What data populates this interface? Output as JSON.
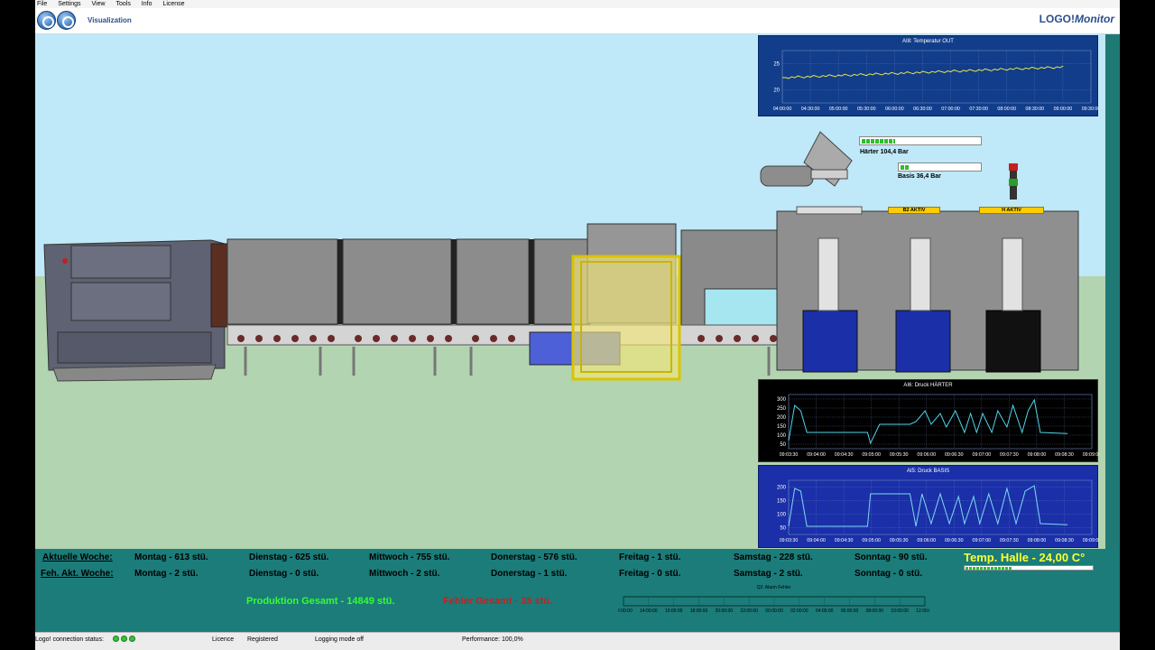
{
  "menu": [
    "File",
    "Settings",
    "View",
    "Tools",
    "Info",
    "License"
  ],
  "toolbar": {
    "title": "Visualization",
    "brand_prefix": "LOGO!",
    "brand_suffix": "Monitor"
  },
  "temperature_chart": {
    "title": "AI8: Temperatur OUT",
    "y_ticks": [
      "25",
      "20"
    ],
    "x_ticks": [
      "04:00:00",
      "04:30:00",
      "05:00:00",
      "05:30:00",
      "06:00:00",
      "06:30:00",
      "07:00:00",
      "07:30:00",
      "08:00:00",
      "08:30:00",
      "09:00:00",
      "09:30:00"
    ]
  },
  "pressure_haerter_chart": {
    "title": "AI6: Druck HÄRTER",
    "y_ticks": [
      "300",
      "250",
      "200",
      "150",
      "100",
      "50"
    ],
    "x_ticks": [
      "09:03:30",
      "09:04:00",
      "09:04:30",
      "09:05:00",
      "09:05:30",
      "09:06:00",
      "09:06:30",
      "09:07:00",
      "09:07:30",
      "09:08:00",
      "09:08:30",
      "09:09:00"
    ]
  },
  "pressure_basis_chart": {
    "title": "AI5: Druck BASIS",
    "y_ticks": [
      "200",
      "150",
      "100",
      "50"
    ],
    "x_ticks": [
      "09:03:30",
      "09:04:00",
      "09:04:30",
      "09:05:00",
      "09:05:30",
      "09:06:00",
      "09:06:30",
      "09:07:00",
      "09:07:30",
      "09:08:00",
      "09:08:30",
      "09:09:00"
    ]
  },
  "gauges": {
    "haerter_label": "Härter 104,4 Bar",
    "haerter_level": 0.28,
    "basis_label": "Basis 36,4 Bar",
    "basis_level": 0.1
  },
  "machine_tags": {
    "b2": "B2 AKTIV",
    "h": "H AKTIV"
  },
  "weekly": {
    "current_week_label": "Aktuelle Woche:",
    "error_week_label": "Feh. Akt. Woche:",
    "current": [
      "Montag - 613 stü.",
      "Dienstag - 625 stü.",
      "Mittwoch - 755 stü.",
      "Donerstag - 576 stü.",
      "Freitag - 1 stü.",
      "Samstag - 228 stü.",
      "Sonntag - 90 stü."
    ],
    "errors": [
      "Montag - 2 stü.",
      "Dienstag - 0 stü.",
      "Mittwoch - 2 stü.",
      "Donerstag - 1 stü.",
      "Freitag - 0 stü.",
      "Samstag - 2 stü.",
      "Sonntag - 0 stü."
    ],
    "temp_hall": "Temp. Halle - 24,00 C°",
    "production_total": "Produktion Gesamt  - 14849 stü.",
    "error_total": "Fehler Gesamt  - 35 stü."
  },
  "alarm_chart": {
    "title": "Q2: Alarm Fehler",
    "x_ticks": [
      "12:00:00",
      "14:00:00",
      "16:00:00",
      "18:00:00",
      "20:00:00",
      "22:00:00",
      "00:00:00",
      "02:00:00",
      "04:00:00",
      "06:00:00",
      "08:00:00",
      "10:00:00",
      "12:00:00"
    ]
  },
  "status": {
    "connection": "Logo! connection status:",
    "licence": "Licence",
    "registered": "Registered",
    "logging": "Logging mode off",
    "performance": "Performance: 100,0%"
  },
  "colors": {
    "teal": "#1b7c79",
    "sky": "#bfe8f8",
    "grass": "#b3d4b1",
    "chart_blue": "#123d8a",
    "chart_black": "#000000"
  }
}
